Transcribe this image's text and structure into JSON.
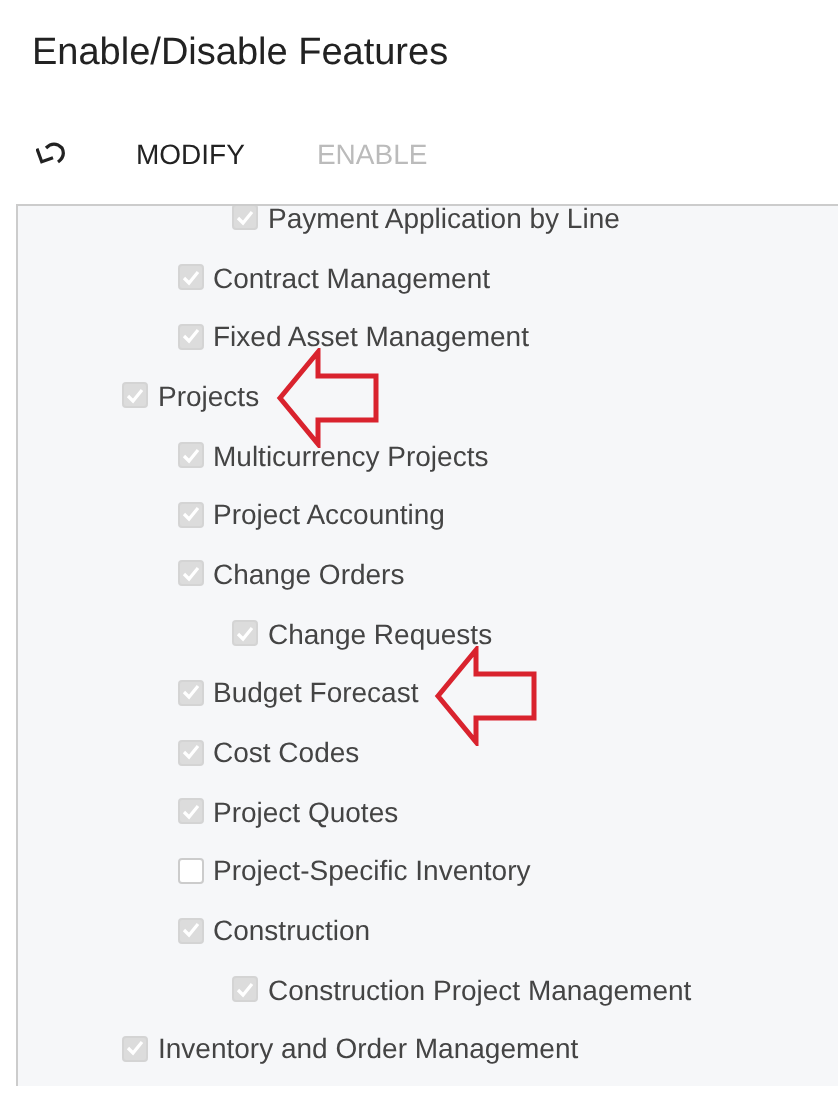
{
  "title": "Enable/Disable Features",
  "toolbar": {
    "buttons": [
      {
        "kind": "undo",
        "disabled": false
      },
      {
        "kind": "text",
        "label": "MODIFY",
        "disabled": false
      },
      {
        "kind": "text",
        "label": "ENABLE",
        "disabled": true
      }
    ]
  },
  "tree": [
    {
      "children": [
        {
          "children": [
            {
              "label": "Payment Application by Line",
              "checked": true,
              "marked": false
            }
          ]
        },
        {
          "label": "Contract Management",
          "checked": true,
          "marked": false
        },
        {
          "label": "Fixed Asset Management",
          "checked": true,
          "marked": false
        }
      ]
    },
    {
      "label": "Projects",
      "checked": true,
      "marked": true,
      "children": [
        {
          "label": "Multicurrency Projects",
          "checked": true,
          "marked": false
        },
        {
          "label": "Project Accounting",
          "checked": true,
          "marked": false
        },
        {
          "label": "Change Orders",
          "checked": true,
          "marked": false,
          "children": [
            {
              "label": "Change Requests",
              "checked": true,
              "marked": false
            }
          ]
        },
        {
          "label": "Budget Forecast",
          "checked": true,
          "marked": true
        },
        {
          "label": "Cost Codes",
          "checked": true,
          "marked": false
        },
        {
          "label": "Project Quotes",
          "checked": true,
          "marked": false
        },
        {
          "label": "Project-Specific Inventory",
          "checked": false,
          "marked": false
        },
        {
          "label": "Construction",
          "checked": true,
          "marked": false,
          "children": [
            {
              "label": "Construction Project Management",
              "checked": true,
              "marked": false
            }
          ]
        }
      ]
    },
    {
      "label": "Inventory and Order Management",
      "checked": true,
      "marked": false
    }
  ]
}
